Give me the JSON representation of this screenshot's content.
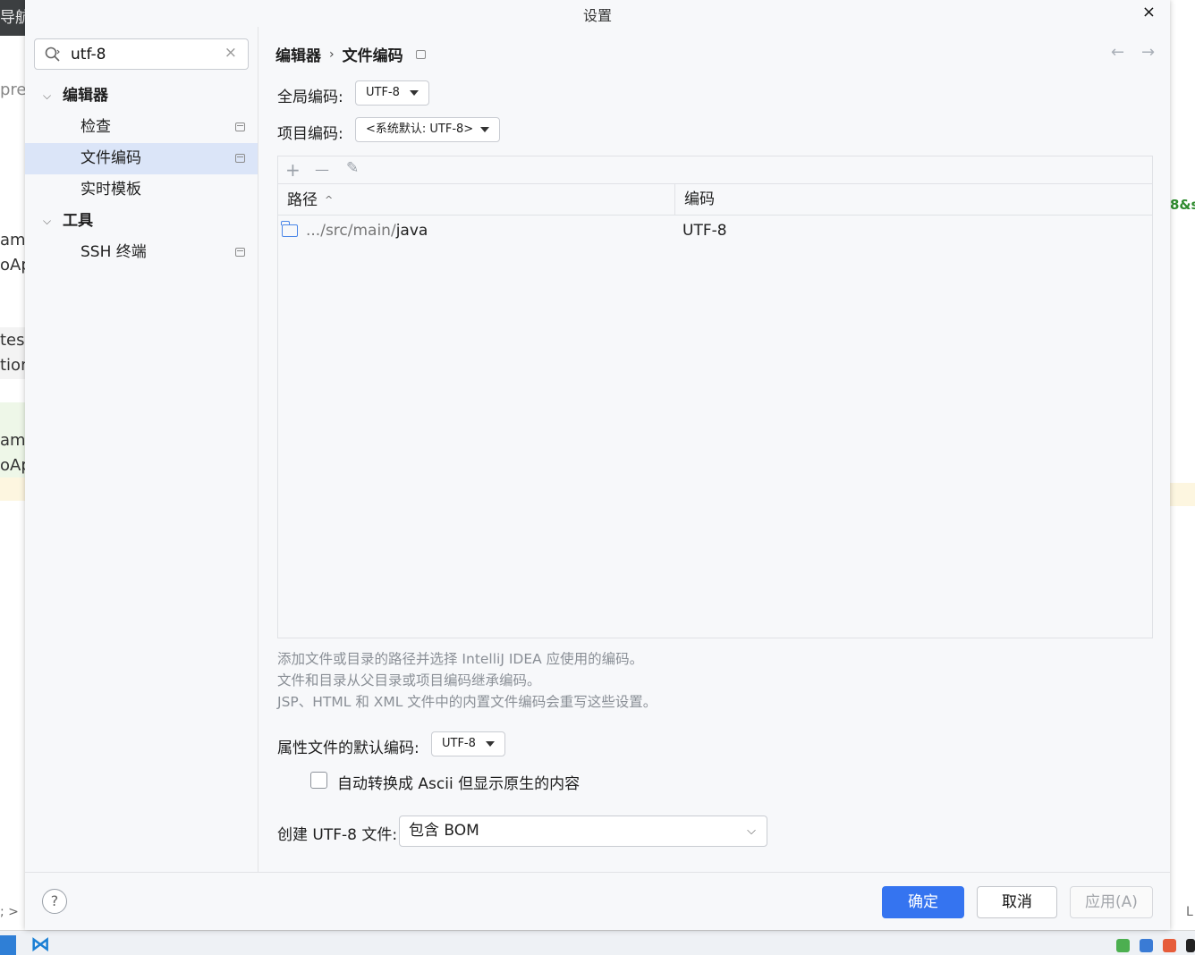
{
  "background": {
    "top_left_text": "导航(",
    "left_fragments": [
      "prev",
      "amp",
      "oAp",
      "tes",
      "tion",
      "amp",
      "oAp"
    ],
    "right_fragment": "8&s",
    "statusbar_left": "; >",
    "statusbar_right": "L"
  },
  "dialog": {
    "title": "设置",
    "close_label": "×"
  },
  "search": {
    "value": "utf-8",
    "clear_label": "×"
  },
  "sidebar": {
    "items": [
      {
        "label": "编辑器",
        "level": 0,
        "expanded": true,
        "bold": true
      },
      {
        "label": "检查",
        "level": 1
      },
      {
        "label": "文件编码",
        "level": 1,
        "selected": true
      },
      {
        "label": "实时模板",
        "level": 1
      },
      {
        "label": "工具",
        "level": 0,
        "expanded": true,
        "bold": true
      },
      {
        "label": "SSH 终端",
        "level": 1
      }
    ]
  },
  "breadcrumb": {
    "parent": "编辑器",
    "separator": "›",
    "current": "文件编码"
  },
  "nav": {
    "back": "←",
    "forward": "→"
  },
  "global_encoding": {
    "label": "全局编码:",
    "value": "UTF-8"
  },
  "project_encoding": {
    "label": "项目编码:",
    "value": "<系统默认: UTF-8>"
  },
  "table": {
    "toolbar": {
      "add": "+",
      "remove": "—",
      "edit": "✎"
    },
    "columns": [
      "路径",
      "编码"
    ],
    "sort_indicator": "^",
    "rows": [
      {
        "path_prefix": ".../src/main/",
        "path_name": "java",
        "encoding": "UTF-8"
      }
    ]
  },
  "hints": [
    "添加文件或目录的路径并选择 IntelliJ IDEA 应使用的编码。",
    "文件和目录从父目录或项目编码继承编码。",
    "JSP、HTML 和 XML 文件中的内置文件编码会重写这些设置。"
  ],
  "properties_encoding": {
    "label": "属性文件的默认编码:",
    "value": "UTF-8"
  },
  "ascii_checkbox": {
    "label": "自动转换成 Ascii 但显示原生的内容",
    "checked": false
  },
  "create_utf8": {
    "label": "创建 UTF-8 文件:",
    "value": "包含 BOM"
  },
  "footer": {
    "help": "?",
    "ok": "确定",
    "cancel": "取消",
    "apply": "应用(A)"
  },
  "colors": {
    "accent": "#3574f0",
    "selection": "#dbe5f8",
    "folder_icon": "#4a86e8"
  }
}
